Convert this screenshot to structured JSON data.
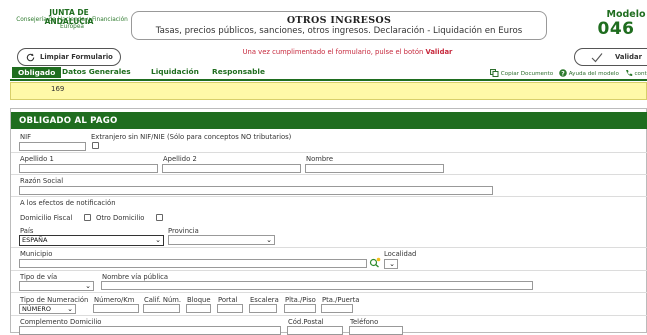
{
  "header": {
    "org_title": "JUNTA DE ANDALUCIA",
    "org_subtitle_line1": "Consejería de Hacienda y Financiación",
    "org_subtitle_line2": "Europea",
    "form_title": "OTROS INGRESOS",
    "form_subtitle": "Tasas, precios públicos, sanciones, otros ingresos. Declaración - Liquidación en Euros",
    "modelo_label": "Modelo",
    "modelo_number": "046"
  },
  "toolbar": {
    "clear_label": "Limpiar Formulario",
    "notice_prefix": "Una vez cumplimentado el formulario, pulse el botón ",
    "notice_bold": "Validar",
    "validate_label": "Validar",
    "copy_doc": "Copiar Documento",
    "help": "Ayuda del modelo",
    "contact": "contact"
  },
  "tabs": [
    "Obligado",
    "Datos Generales",
    "Liquidación",
    "Responsable"
  ],
  "active_tab": "Obligado",
  "yellow_value": "169",
  "section": {
    "title": "OBLIGADO AL PAGO",
    "nif_label": "NIF",
    "extranjero_label": "Extranjero sin NIF/NIE (Sólo para conceptos NO tributarios)",
    "apellido1_label": "Apellido 1",
    "apellido2_label": "Apellido 2",
    "nombre_label": "Nombre",
    "razon_label": "Razón Social",
    "notificacion_label": "A los efectos de notificación",
    "domicilio_fiscal_label": "Domicilio Fiscal",
    "otro_domicilio_label": "Otro Domicilio",
    "pais_label": "País",
    "pais_value": "ESPAÑA",
    "provincia_label": "Provincia",
    "municipio_label": "Municipio",
    "localidad_label": "Localidad",
    "tipo_via_label": "Tipo de vía",
    "nombre_via_label": "Nombre vía pública",
    "tipo_num_label": "Tipo de Numeración",
    "tipo_num_value": "NÚMERO",
    "numero_label": "Número/Km",
    "calif_label": "Calif. Núm.",
    "bloque_label": "Bloque",
    "portal_label": "Portal",
    "escalera_label": "Escalera",
    "planta_label": "Plta./Piso",
    "puerta_label": "Pta./Puerta",
    "complemento_label": "Complemento Domicilio",
    "cod_postal_label": "Cód.Postal",
    "telefono_label": "Teléfono"
  },
  "colors": {
    "brand_green": "#1f6d1f",
    "notice_red": "#c6283c",
    "yellow_bg": "#fff9a8"
  }
}
